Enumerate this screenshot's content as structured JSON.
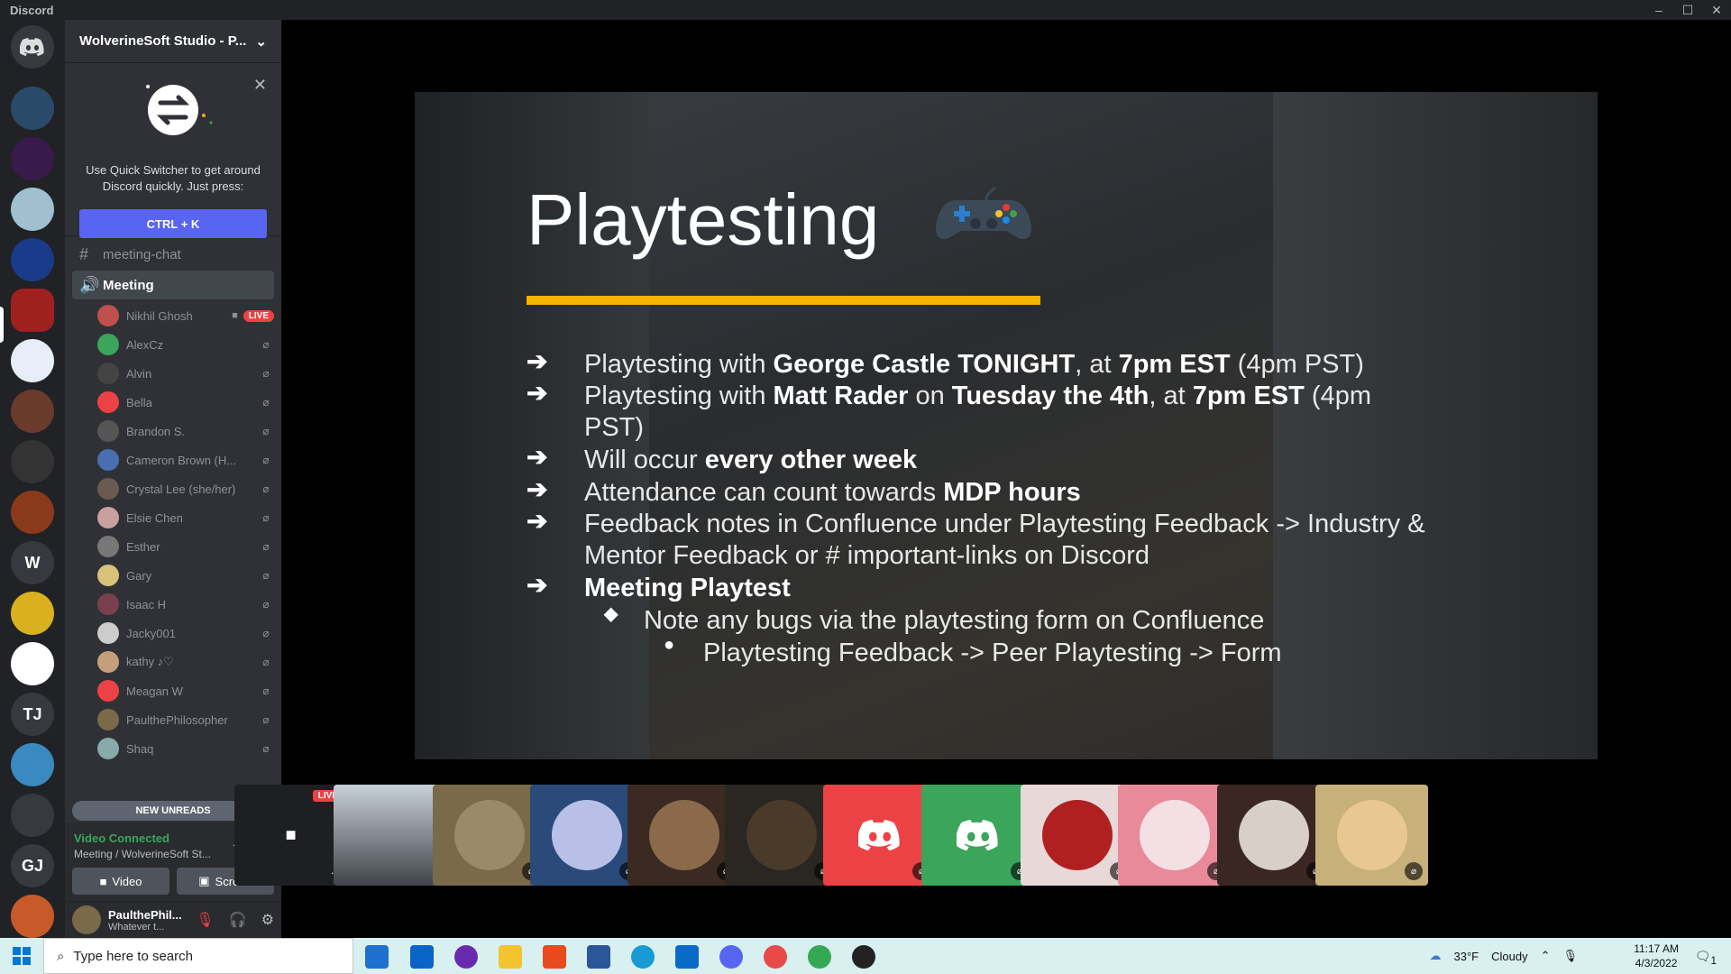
{
  "titlebar": {
    "app": "Discord",
    "min": "–",
    "max": "☐",
    "close": "✕"
  },
  "rail": {
    "initials": [
      "W",
      "TJ",
      "GJ"
    ]
  },
  "guild": {
    "name": "WolverineSoft Studio - P...",
    "chevron": "⌄"
  },
  "quick_switcher": {
    "description": "Use Quick Switcher to get around Discord quickly. Just press:",
    "shortcut": "CTRL + K",
    "close": "✕"
  },
  "channels": {
    "text": {
      "label": "meeting-chat",
      "icon": "hash-icon"
    },
    "voice": {
      "label": "Meeting",
      "icon": "speaker-icon"
    }
  },
  "voice_users": [
    {
      "name": "Nikhil Ghosh",
      "live": "LIVE",
      "color": "#c0504d"
    },
    {
      "name": "AlexCz",
      "color": "#3ba55c"
    },
    {
      "name": "Alvin",
      "color": "#444"
    },
    {
      "name": "Bella",
      "color": "#ed4245"
    },
    {
      "name": "Brandon S.",
      "color": "#555"
    },
    {
      "name": "Cameron Brown (H...",
      "color": "#4a6fb0"
    },
    {
      "name": "Crystal Lee (she/her)",
      "color": "#6a5a50"
    },
    {
      "name": "Elsie Chen",
      "color": "#c9a0a0"
    },
    {
      "name": "Esther",
      "color": "#777"
    },
    {
      "name": "Gary",
      "color": "#d8c27a"
    },
    {
      "name": "Isaac H",
      "color": "#7a4050"
    },
    {
      "name": "Jacky001",
      "color": "#ccc"
    },
    {
      "name": "kathy ♪♡",
      "color": "#c4a07a"
    },
    {
      "name": "Meagan W",
      "color": "#ed4245"
    },
    {
      "name": "PaulthePhilosopher",
      "color": "#7a6a4a"
    },
    {
      "name": "Shaq",
      "color": "#8aa"
    }
  ],
  "new_unreads": "NEW UNREADS",
  "voice_connection": {
    "status": "Video Connected",
    "location": "Meeting / WolverineSoft St...",
    "video_label": "Video",
    "screen_label": "Screen"
  },
  "user": {
    "name": "PaulthePhil...",
    "status": "Whatever t..."
  },
  "slide": {
    "title": "Playtesting",
    "bullets": [
      {
        "parts": [
          {
            "t": "Playtesting with "
          },
          {
            "t": "George Castle TONIGHT",
            "b": true
          },
          {
            "t": ", at "
          },
          {
            "t": "7pm EST",
            "b": true
          },
          {
            "t": " (4pm PST)"
          }
        ]
      },
      {
        "parts": [
          {
            "t": "Playtesting with "
          },
          {
            "t": "Matt Rader",
            "b": true
          },
          {
            "t": " on "
          },
          {
            "t": "Tuesday the 4th",
            "b": true
          },
          {
            "t": ", at "
          },
          {
            "t": "7pm EST",
            "b": true
          },
          {
            "t": " (4pm"
          }
        ]
      },
      {
        "parts": [
          {
            "t": "PST)"
          }
        ]
      },
      {
        "parts": [
          {
            "t": "Will occur "
          },
          {
            "t": "every other week",
            "b": true
          }
        ]
      },
      {
        "parts": [
          {
            "t": "Attendance can count towards "
          },
          {
            "t": "MDP hours",
            "b": true
          }
        ]
      },
      {
        "parts": [
          {
            "t": "Feedback notes in Confluence under Playtesting Feedback -> Industry &"
          }
        ]
      },
      {
        "parts": [
          {
            "t": "Mentor Feedback or # important-links on Discord"
          }
        ]
      },
      {
        "parts": [
          {
            "t": "Meeting Playtest",
            "b": true
          }
        ]
      },
      {
        "parts": [
          {
            "t": "Note any bugs via the playtesting form on Confluence"
          }
        ]
      },
      {
        "parts": [
          {
            "t": "Playtesting Feedback -> Peer Playtesting -> Form"
          }
        ]
      }
    ]
  },
  "tiles": {
    "live_label": "LIVE",
    "more": "..."
  },
  "taskbar": {
    "search_placeholder": "Type here to search",
    "temp": "33°F",
    "weather": "Cloudy",
    "time": "11:17 AM",
    "date": "4/3/2022",
    "notifications": "1"
  },
  "colors": {
    "blurple": "#5865f2",
    "green": "#3ba55c",
    "red": "#ed4245",
    "accent_bar": "#f4b400"
  }
}
